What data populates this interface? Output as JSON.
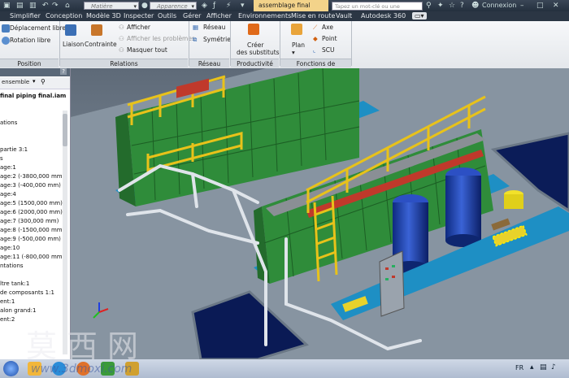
{
  "titlebar": {
    "material_placeholder": "Matière",
    "appearance_placeholder": "Apparence",
    "document_tab": "assemblage final pipin...",
    "search_placeholder": "Tapez un mot-clé ou une expression",
    "user": "Connexion"
  },
  "menu": {
    "tabs": [
      "Simplifier",
      "Conception",
      "Modèle 3D",
      "Inspecter",
      "Outils",
      "Gérer",
      "Afficher",
      "Environnements",
      "Mise en route",
      "Vault",
      "Autodesk 360"
    ]
  },
  "ribbon": {
    "position": {
      "move": "Déplacement libre",
      "rotate": "Rotation libre",
      "label": "Position"
    },
    "relations": {
      "link": "Liaison",
      "constraint": "Contrainte",
      "show": "Afficher",
      "show_problems": "Afficher les problèmes",
      "hide_all": "Masquer tout",
      "label": "Relations"
    },
    "network": {
      "network": "Réseau",
      "symmetry": "Symétrie",
      "label": "Réseau"
    },
    "productivity": {
      "create_line1": "Créer",
      "create_line2": "des substituts",
      "label": "Productivité"
    },
    "construction": {
      "plane": "Plan",
      "axis": "Axe",
      "point": "Point",
      "ucs": "SCU",
      "label": "Fonctions de construction"
    }
  },
  "browser": {
    "help": "?",
    "mode": "ensemble",
    "items": [
      "final piping final.iam",
      "",
      "ations",
      "",
      "",
      "partie 3:1",
      "s",
      "age:1",
      "age:2 (-3800,000 mm)",
      "age:3 (-400,000 mm)",
      "age:4",
      "age:5 (1500,000 mm)",
      "age:6 (2000,000 mm)",
      "age:7 (300,000 mm)",
      "age:8 (-1500,000 mm)",
      "age:9 (-500,000 mm)",
      "age:10",
      "age:11 (-800,000 mm)",
      "ntations",
      "",
      "ltre tank:1",
      "de composants 1:1",
      "ent:1",
      "alon grand:1",
      "ent:2"
    ]
  },
  "taskbar": {
    "lang": "FR"
  },
  "watermark": {
    "cn": "莫西网",
    "url": "www.3dmoxi.com"
  },
  "colors": {
    "accent": "#f3d38a",
    "tank": "#2f8c3a",
    "vessel": "#1f3fa8",
    "rail": "#e8c21a"
  }
}
